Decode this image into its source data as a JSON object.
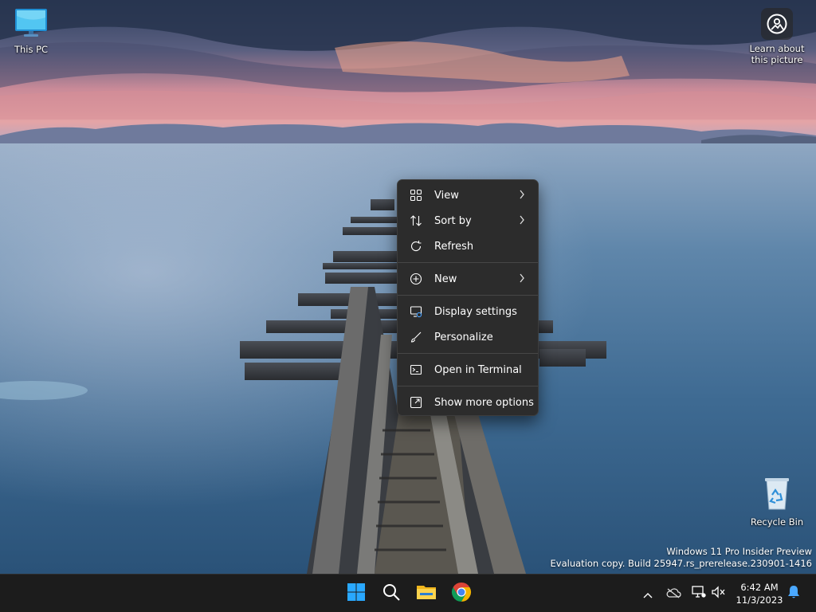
{
  "desktop": {
    "icons": {
      "this_pc": "This PC",
      "recycle_bin": "Recycle Bin",
      "learn_line1": "Learn about",
      "learn_line2": "this picture"
    },
    "watermark": {
      "line1": "Windows 11 Pro Insider Preview",
      "line2": "Evaluation copy. Build 25947.rs_prerelease.230901-1416"
    }
  },
  "context_menu": {
    "items": [
      {
        "label": "View",
        "icon": "grid-icon",
        "submenu": true
      },
      {
        "label": "Sort by",
        "icon": "sort-icon",
        "submenu": true
      },
      {
        "label": "Refresh",
        "icon": "refresh-icon",
        "submenu": false
      },
      {
        "label": "New",
        "icon": "plus-circle-icon",
        "submenu": true
      },
      {
        "label": "Display settings",
        "icon": "display-settings-icon",
        "submenu": false
      },
      {
        "label": "Personalize",
        "icon": "brush-icon",
        "submenu": false
      },
      {
        "label": "Open in Terminal",
        "icon": "terminal-icon",
        "submenu": false
      },
      {
        "label": "Show more options",
        "icon": "external-icon",
        "submenu": false
      }
    ]
  },
  "taskbar": {
    "clock_time": "6:42 AM",
    "clock_date": "11/3/2023",
    "pinned": [
      "start-icon",
      "search-icon",
      "file-explorer-icon",
      "chrome-icon"
    ]
  },
  "colors": {
    "menu_bg": "#2c2c2c",
    "taskbar_bg": "#1c1c1c",
    "windows_blue": "#29a8ff"
  }
}
